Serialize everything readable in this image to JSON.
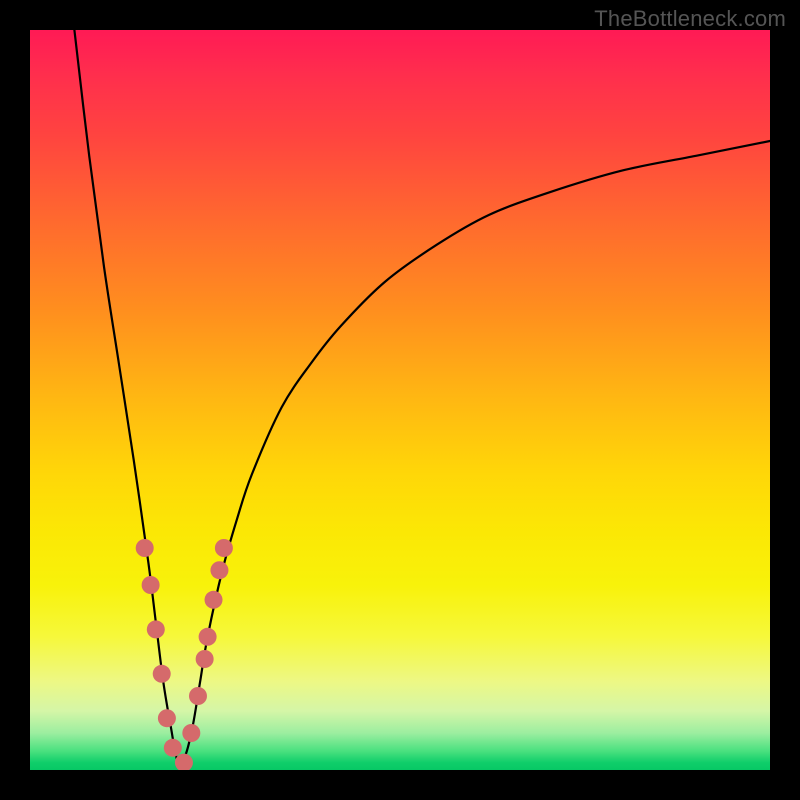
{
  "watermark": "TheBottleneck.com",
  "colors": {
    "frame": "#000000",
    "curve": "#000000",
    "dots": "#d56a6b"
  },
  "chart_data": {
    "type": "line",
    "title": "",
    "xlabel": "",
    "ylabel": "",
    "xlim": [
      0,
      100
    ],
    "ylim": [
      0,
      100
    ],
    "description": "Bottleneck-style V-curve: steep descent on the left limb reaching a minimum near x≈20, then a concave-rising right limb approaching ~85 at x=100. A cluster of data points sits on both limbs near the valley, all below y≈30.",
    "series": [
      {
        "name": "curve",
        "x": [
          6,
          8,
          10,
          12,
          14,
          16,
          17,
          18,
          19,
          20,
          21,
          22,
          23,
          24,
          26,
          28,
          30,
          34,
          38,
          42,
          48,
          55,
          62,
          70,
          80,
          90,
          100
        ],
        "y": [
          100,
          83,
          68,
          55,
          42,
          28,
          20,
          12,
          6,
          1,
          2,
          6,
          12,
          18,
          27,
          34,
          40,
          49,
          55,
          60,
          66,
          71,
          75,
          78,
          81,
          83,
          85
        ]
      }
    ],
    "points": [
      {
        "x": 15.5,
        "y": 30
      },
      {
        "x": 16.3,
        "y": 25
      },
      {
        "x": 17.0,
        "y": 19
      },
      {
        "x": 17.8,
        "y": 13
      },
      {
        "x": 18.5,
        "y": 7
      },
      {
        "x": 19.3,
        "y": 3
      },
      {
        "x": 20.8,
        "y": 1
      },
      {
        "x": 21.8,
        "y": 5
      },
      {
        "x": 22.7,
        "y": 10
      },
      {
        "x": 23.6,
        "y": 15
      },
      {
        "x": 24.0,
        "y": 18
      },
      {
        "x": 24.8,
        "y": 23
      },
      {
        "x": 25.6,
        "y": 27
      },
      {
        "x": 26.2,
        "y": 30
      }
    ],
    "point_radius": 9
  }
}
